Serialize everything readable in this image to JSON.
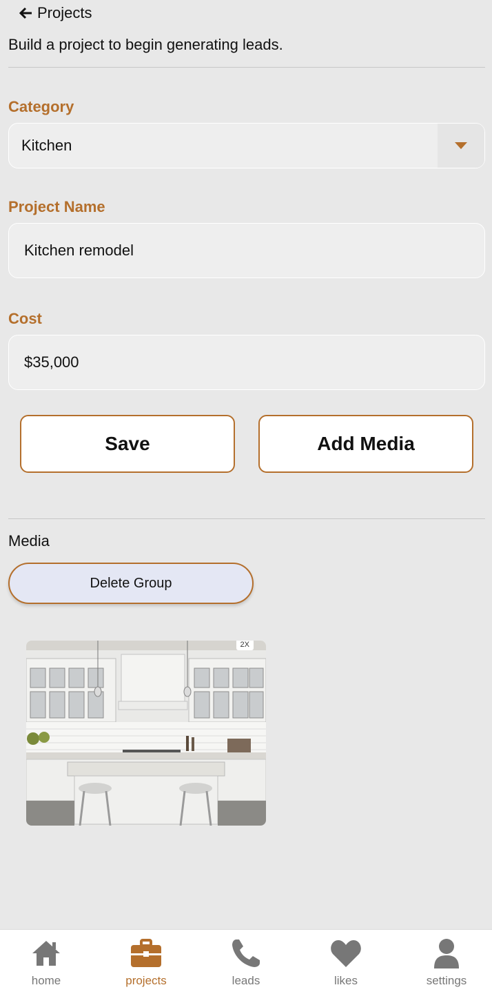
{
  "header": {
    "back_label": "Projects",
    "subtitle": "Build a project to begin generating leads."
  },
  "form": {
    "category_label": "Category",
    "category_value": "Kitchen",
    "name_label": "Project Name",
    "name_value": "Kitchen remodel",
    "cost_label": "Cost",
    "cost_value": "$35,000"
  },
  "actions": {
    "save": "Save",
    "add_media": "Add Media"
  },
  "media": {
    "title": "Media",
    "delete_group": "Delete Group",
    "badge": "2X",
    "image_icon": "kitchen-photo"
  },
  "colors": {
    "accent": "#b46f2c",
    "inactive": "#777777",
    "background": "#e8e8e8"
  },
  "tabs": [
    {
      "label": "home",
      "icon": "home-icon"
    },
    {
      "label": "projects",
      "icon": "briefcase-icon"
    },
    {
      "label": "leads",
      "icon": "phone-icon"
    },
    {
      "label": "likes",
      "icon": "heart-icon"
    },
    {
      "label": "settings",
      "icon": "user-icon"
    }
  ]
}
